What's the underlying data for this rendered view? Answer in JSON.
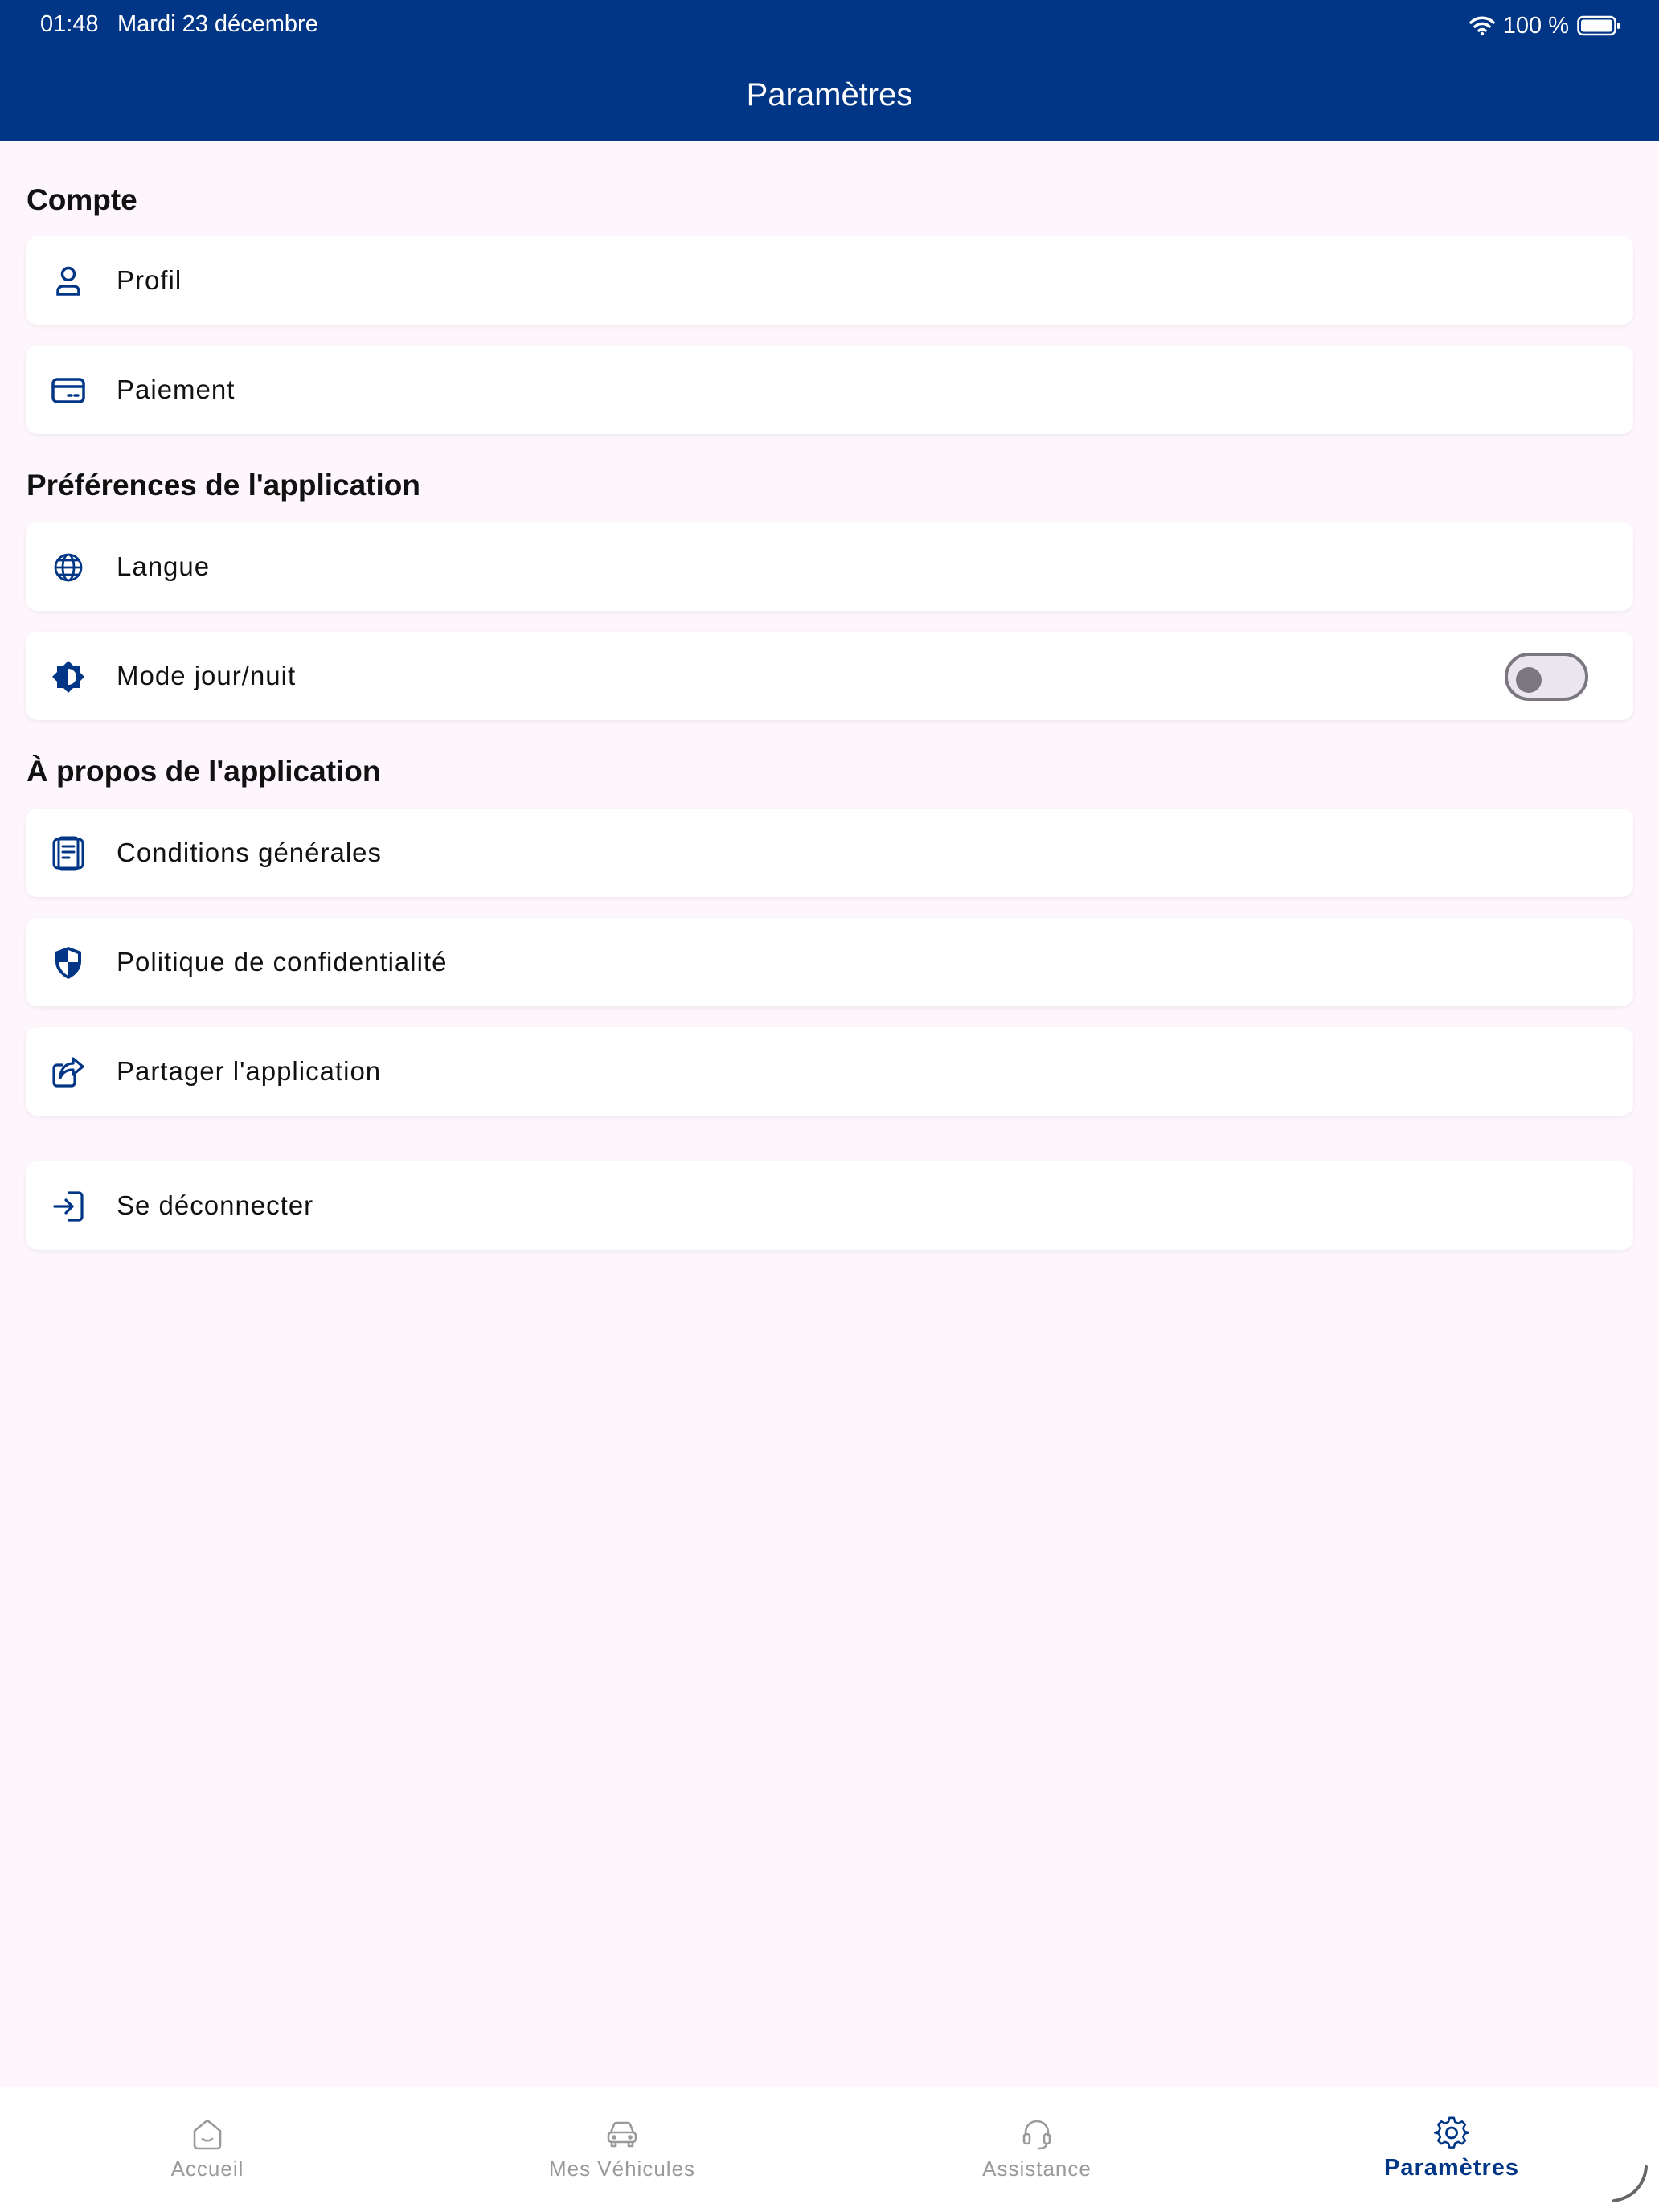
{
  "status_bar": {
    "time": "01:48",
    "date": "Mardi 23 décembre",
    "battery": "100 %"
  },
  "header": {
    "title": "Paramètres"
  },
  "sections": {
    "account": {
      "title": "Compte",
      "items": [
        {
          "label": "Profil",
          "icon": "person-icon"
        },
        {
          "label": "Paiement",
          "icon": "credit-card-icon"
        }
      ]
    },
    "preferences": {
      "title": "Préférences de l'application",
      "items": [
        {
          "label": "Langue",
          "icon": "globe-icon"
        },
        {
          "label": "Mode jour/nuit",
          "icon": "brightness-icon",
          "toggle_on": false
        }
      ]
    },
    "about": {
      "title": "À propos de l'application",
      "items": [
        {
          "label": "Conditions générales",
          "icon": "document-icon"
        },
        {
          "label": "Politique de confidentialité",
          "icon": "shield-icon"
        },
        {
          "label": "Partager l'application",
          "icon": "share-icon"
        }
      ]
    },
    "logout": {
      "label": "Se déconnecter",
      "icon": "logout-icon"
    }
  },
  "bottom_nav": {
    "items": [
      {
        "label": "Accueil",
        "icon": "home-icon",
        "active": false
      },
      {
        "label": "Mes Véhicules",
        "icon": "car-icon",
        "active": false
      },
      {
        "label": "Assistance",
        "icon": "headset-icon",
        "active": false
      },
      {
        "label": "Paramètres",
        "icon": "gear-icon",
        "active": true
      }
    ]
  },
  "colors": {
    "primary": "#003685",
    "background": "#fdf7fd",
    "card": "#ffffff",
    "inactive": "#9a9a9a"
  }
}
